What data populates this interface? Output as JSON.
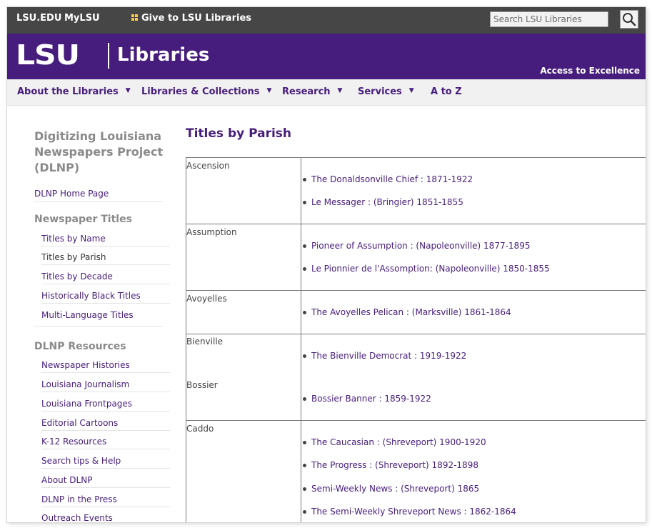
{
  "topbar": {
    "lsu_link": "LSU.EDU",
    "mylsu_link": "MyLSU",
    "give_link": "Give to LSU Libraries",
    "search_placeholder": "Search LSU Libraries"
  },
  "banner": {
    "logo_text": "LSU",
    "libraries": "Libraries",
    "tagline": "Access to Excellence"
  },
  "nav": {
    "items": [
      "About the Libraries",
      "Libraries & Collections",
      "Research",
      "Services",
      "A to Z"
    ]
  },
  "sidebar": {
    "title": "Digitizing Louisiana Newspapers Project (DLNP)",
    "home_link": "DLNP Home Page",
    "newspaper_titles": {
      "heading": "Newspaper Titles",
      "links": [
        "Titles by Name",
        "Titles by Parish",
        "Titles by Decade",
        "Historically Black Titles",
        "Multi-Language Titles"
      ]
    },
    "resources": {
      "heading": "DLNP Resources",
      "links": [
        "Newspaper Histories",
        "Louisiana Journalism",
        "Louisiana Frontpages",
        "Editorial Cartoons",
        "K-12 Resources",
        "Search tips & Help",
        "About DLNP",
        "DLNP in the Press",
        "Outreach Events"
      ]
    }
  },
  "main": {
    "title": "Titles by Parish",
    "parishes": [
      {
        "name": "Ascension",
        "titles": [
          "The Donaldsonville Chief : 1871-1922",
          "Le Messager : (Bringier) 1851-1855"
        ]
      },
      {
        "name": "Assumption",
        "titles": [
          "Pioneer of Assumption : (Napoleonville) 1877-1895",
          "Le Pionnier de l'Assomption: (Napoleonville) 1850-1855"
        ]
      },
      {
        "name": "Avoyelles",
        "titles": [
          "The Avoyelles Pelican : (Marksville) 1861-1864"
        ]
      },
      {
        "name": "Bienville",
        "titles": [
          "The Bienville Democrat : 1919-1922"
        ]
      },
      {
        "name": "Bossier",
        "titles": [
          "Bossier Banner : 1859-1922"
        ]
      },
      {
        "name": "Caddo",
        "titles": [
          "The Caucasian : (Shreveport) 1900-1920",
          "The Progress : (Shreveport) 1892-1898",
          "Semi-Weekly News : (Shreveport) 1865",
          "The Semi-Weekly Shreveport News : 1862-1864"
        ]
      }
    ]
  },
  "colors": {
    "purple": "#461d7c",
    "topbar": "#464646",
    "gold": "#f5c84c"
  }
}
